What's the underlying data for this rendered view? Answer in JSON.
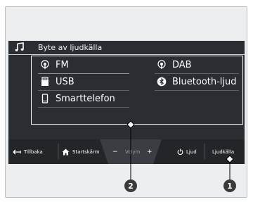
{
  "header": {
    "title": "Byte av ljudkälla",
    "icon": "music-note-icon"
  },
  "sources": [
    {
      "label": "FM",
      "icon": "radio-antenna-icon"
    },
    {
      "label": "DAB",
      "icon": "radio-antenna-icon"
    },
    {
      "label": "USB",
      "icon": "usb-icon"
    },
    {
      "label": "Bluetooth-ljud",
      "icon": "bluetooth-icon"
    },
    {
      "label": "Smarttelefon",
      "icon": "smartphone-icon"
    }
  ],
  "bottom_bar": {
    "back_label": "Tillbaka",
    "home_label": "Startskärm",
    "volume_minus": "−",
    "volume_label": "Volym",
    "volume_plus": "+",
    "audio_label": "Ljud",
    "source_label": "Ljudkälla"
  },
  "callouts": {
    "one": "1",
    "two": "2"
  },
  "colors": {
    "screen_bg": "#2a2d31",
    "bar_bg": "#232629",
    "frame_bg": "#eceef0",
    "text": "#ffffff"
  }
}
